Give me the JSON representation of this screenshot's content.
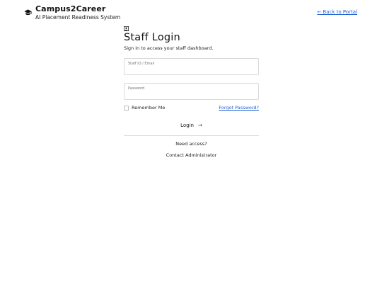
{
  "header": {
    "brand_icon": "graduation-cap-icon",
    "title": "Campus2Career",
    "subtitle": "AI Placement Readiness System",
    "back_link": "← Back to Portal"
  },
  "login": {
    "icon": "id-badge-icon",
    "title": "Staff Login",
    "subtitle": "Sign in to access your staff dashboard.",
    "id_field": {
      "label": "Staff ID / Email",
      "value": ""
    },
    "password_field": {
      "label": "Password",
      "value": ""
    },
    "remember_label": "Remember Me",
    "forgot_link": "Forgot Password?",
    "submit_label": "Login",
    "submit_icon": "arrow-right-icon",
    "need_access": "Need access?",
    "contact_admin": "Contact Administrator"
  },
  "colors": {
    "link": "#1f5fd1",
    "border": "#d9d9d9",
    "text": "#111111"
  }
}
